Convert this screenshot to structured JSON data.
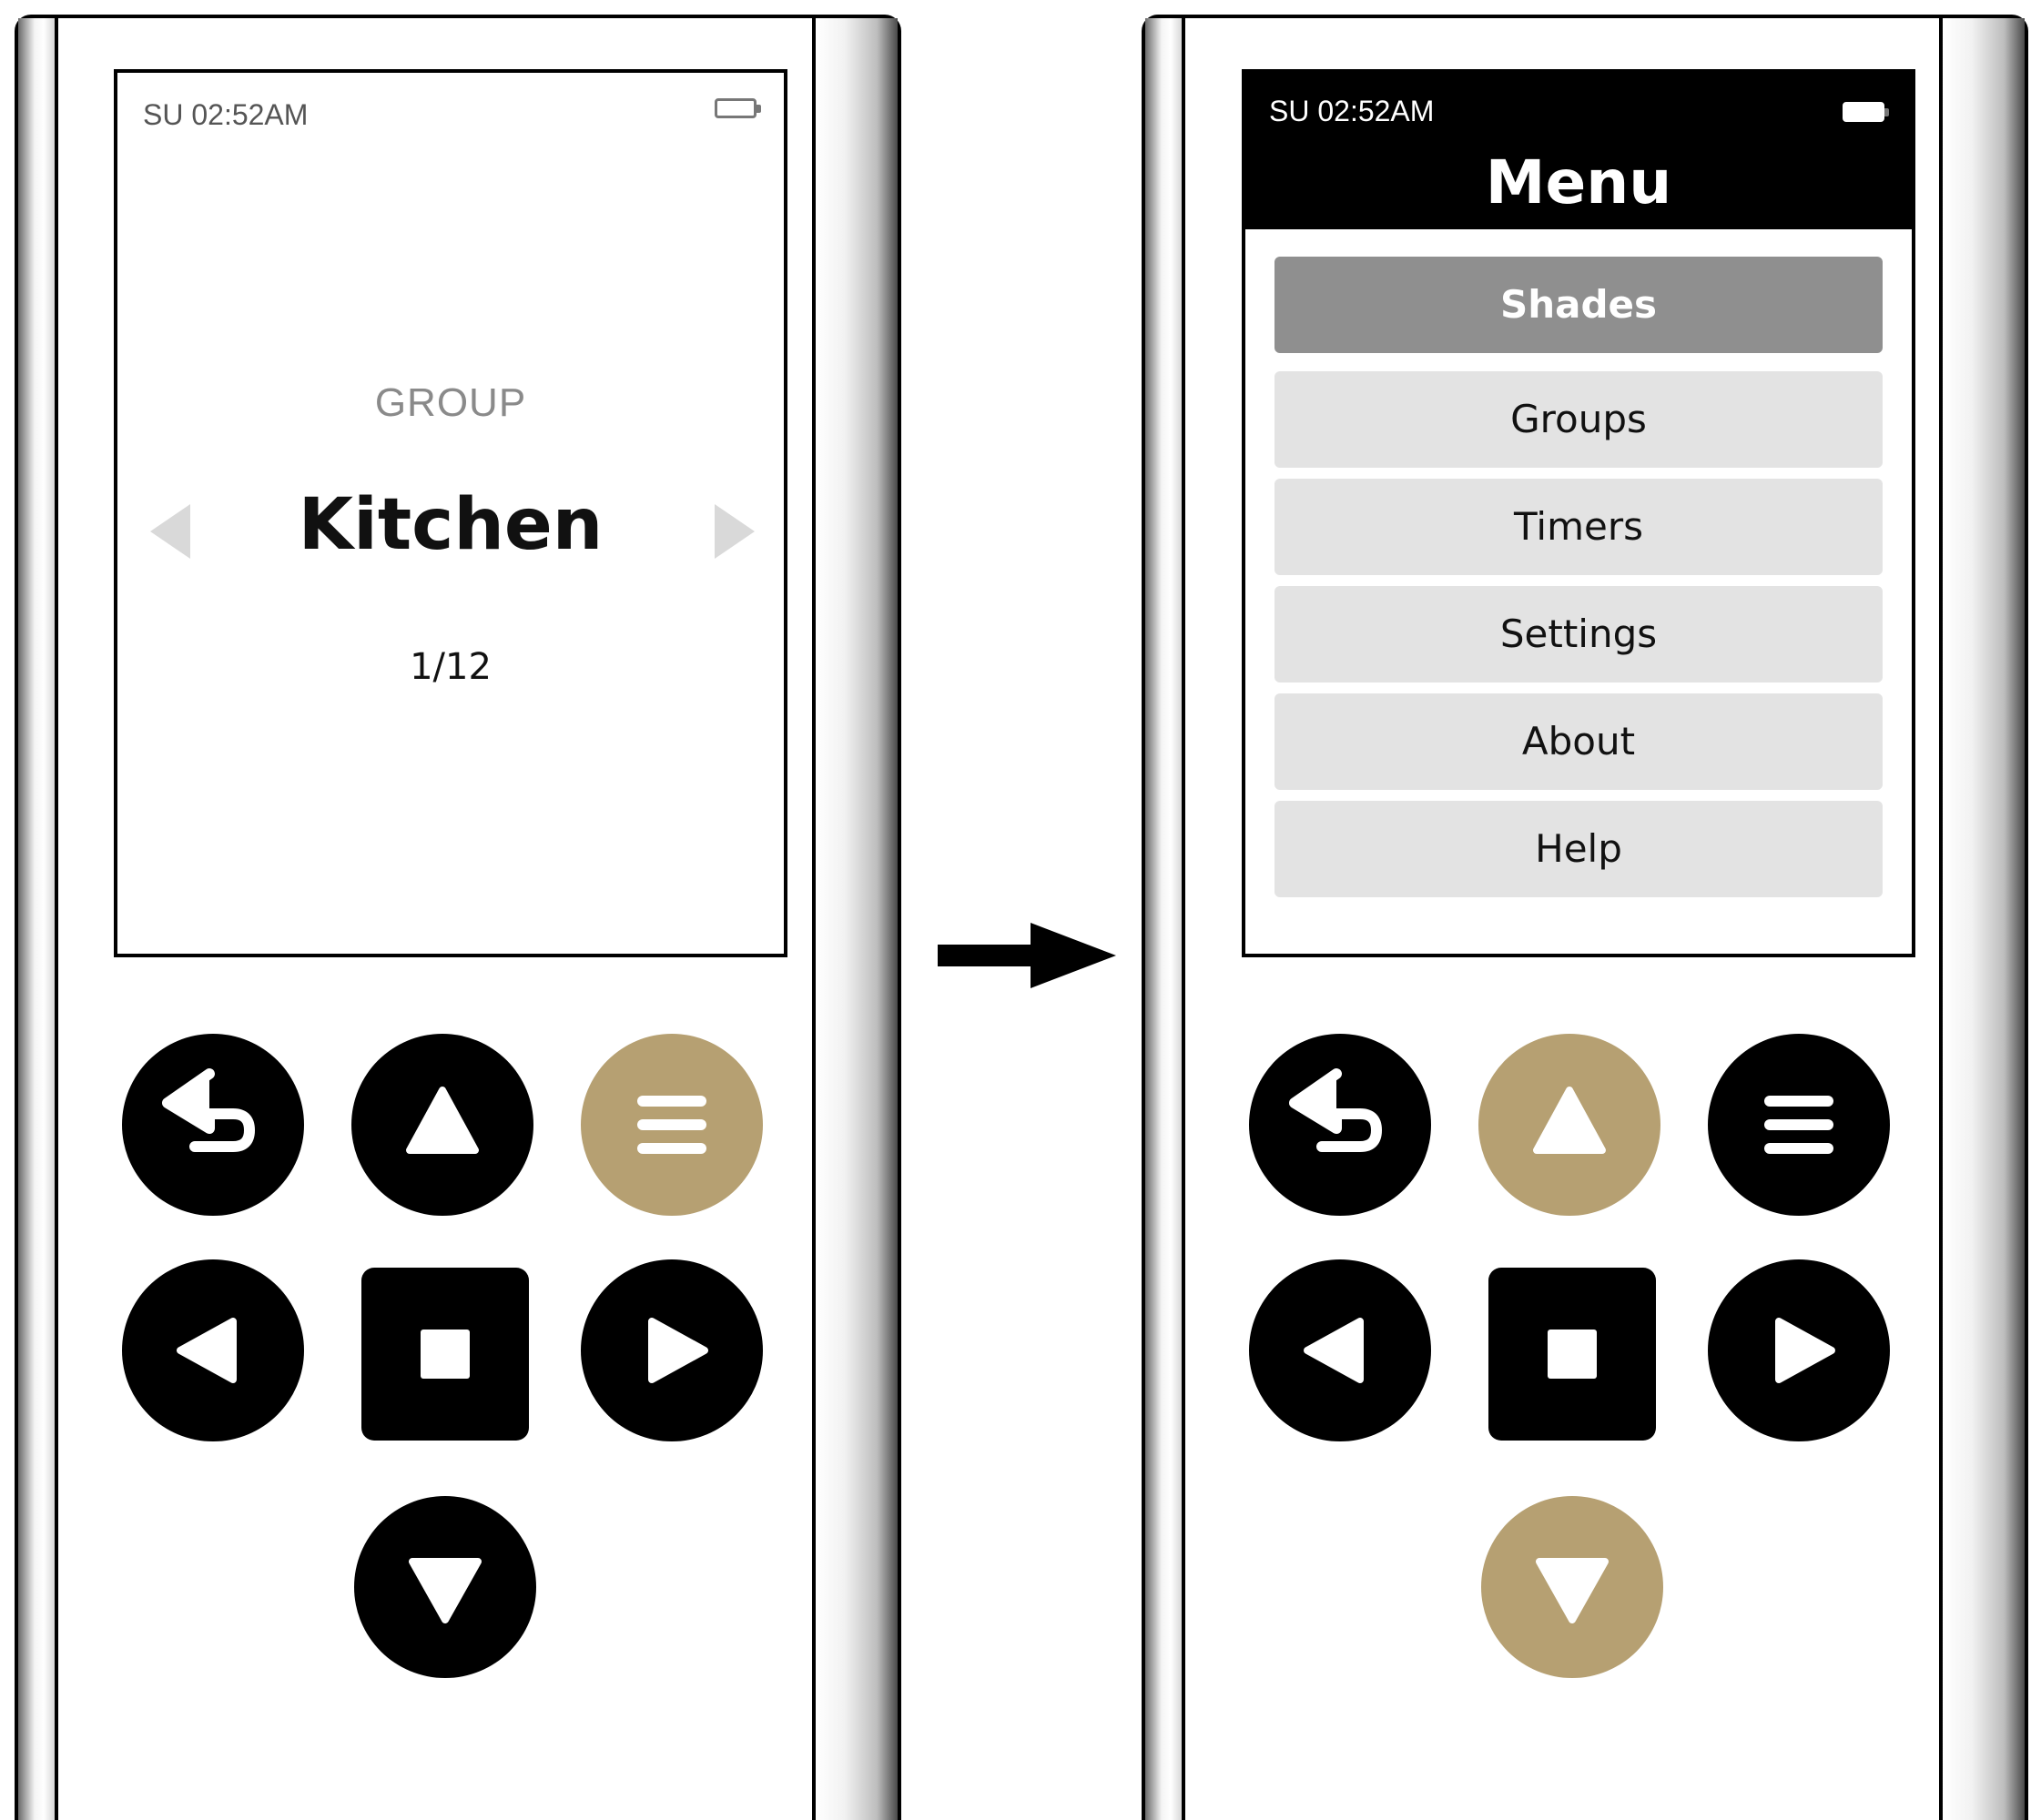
{
  "left_device": {
    "status": {
      "time": "SU 02:52AM",
      "battery_icon": "battery-icon"
    },
    "group_caption": "GROUP",
    "group_name": "Kitchen",
    "group_index": "1/12",
    "nav_icons": [
      "chevron-left-icon",
      "chevron-right-icon"
    ],
    "buttons": {
      "back": {
        "icon": "back-arrow-icon",
        "color": "#000000"
      },
      "up": {
        "icon": "triangle-up-icon",
        "color": "#000000"
      },
      "menu": {
        "icon": "hamburger-icon",
        "color": "#b6a072",
        "highlighted": true
      },
      "left": {
        "icon": "triangle-left-icon",
        "color": "#000000"
      },
      "stop": {
        "icon": "stop-square-icon",
        "color": "#000000"
      },
      "right": {
        "icon": "triangle-right-icon",
        "color": "#000000"
      },
      "down": {
        "icon": "triangle-down-icon",
        "color": "#000000"
      }
    }
  },
  "transition_arrow": "arrow-right-icon",
  "right_device": {
    "status": {
      "time": "SU 02:52AM",
      "battery_icon": "battery-icon"
    },
    "menu_title": "Menu",
    "menu_items": [
      {
        "label": "Shades",
        "selected": true
      },
      {
        "label": "Groups",
        "selected": false
      },
      {
        "label": "Timers",
        "selected": false
      },
      {
        "label": "Settings",
        "selected": false
      },
      {
        "label": "About",
        "selected": false
      },
      {
        "label": "Help",
        "selected": false
      }
    ],
    "buttons": {
      "back": {
        "icon": "back-arrow-icon",
        "color": "#000000"
      },
      "up": {
        "icon": "triangle-up-icon",
        "color": "#b6a072",
        "highlighted": true
      },
      "menu": {
        "icon": "hamburger-icon",
        "color": "#000000"
      },
      "left": {
        "icon": "triangle-left-icon",
        "color": "#000000"
      },
      "stop": {
        "icon": "stop-square-icon",
        "color": "#000000"
      },
      "right": {
        "icon": "triangle-right-icon",
        "color": "#000000"
      },
      "down": {
        "icon": "triangle-down-icon",
        "color": "#b6a072",
        "highlighted": true
      }
    }
  },
  "colors": {
    "accent_gold": "#b6a072",
    "button_black": "#000000",
    "menu_selected": "#8f8f8f",
    "menu_item": "#e3e3e3",
    "caption_gray": "#8a8a8a"
  }
}
